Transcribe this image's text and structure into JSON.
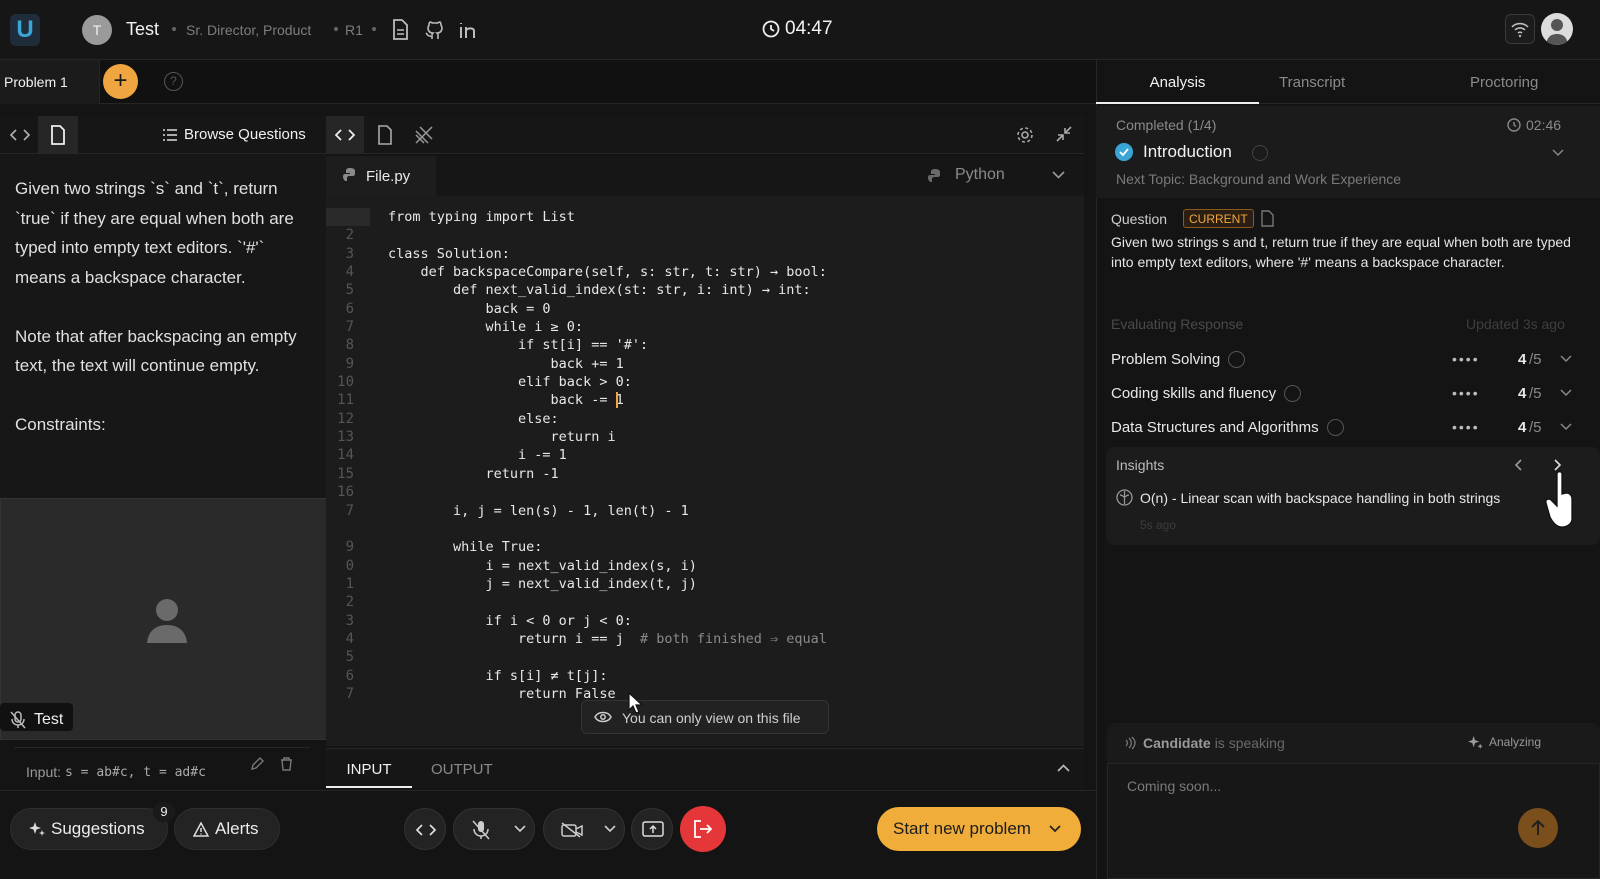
{
  "header": {
    "logo": "U",
    "avatar_initial": "T",
    "candidate_name": "Test",
    "role": "Sr. Director, Product",
    "round": "R1",
    "timer": "04:47",
    "icons": [
      "document-icon",
      "github-icon",
      "linkedin-icon",
      "clock-icon",
      "wifi-icon"
    ]
  },
  "problem_tabs": {
    "current": "Problem 1",
    "add_label": "+",
    "help": "?"
  },
  "left_panel": {
    "browse_label": "Browse Questions",
    "paragraphs": [
      "Given two strings `s` and `t`, return `true` if they are equal when both are typed into empty text editors. `'#'` means a backspace character.",
      "Note that after backspacing an empty text, the text will continue empty.",
      "Constraints:"
    ],
    "video_label": "Test",
    "input_label": "Input:",
    "input_value": "s = ab#c, t = ad#c"
  },
  "editor": {
    "file_name": "File.py",
    "language": "Python",
    "line_numbers": [
      "",
      "2",
      "3",
      "4",
      "5",
      "6",
      "7",
      "8",
      "9",
      "10",
      "11",
      "12",
      "13",
      "14",
      "15",
      "16",
      "7",
      "",
      "9",
      "0",
      "1",
      "2",
      "3",
      "4",
      "5",
      "6",
      "7"
    ],
    "code": [
      "from typing import List",
      "",
      "class Solution:",
      "    def backspaceCompare(self, s: str, t: str) → bool:",
      "        def next_valid_index(st: str, i: int) → int:",
      "            back = 0",
      "            while i ≥ 0:",
      "                if st[i] == '#':",
      "                    back += 1",
      "                elif back > 0:",
      "                    back -= 1",
      "                else:",
      "                    return i",
      "                i -= 1",
      "            return -1",
      "",
      "        i, j = len(s) - 1, len(t) - 1",
      "",
      "        while True:",
      "            i = next_valid_index(s, i)",
      "            j = next_valid_index(t, j)",
      "",
      "            if i < 0 or j < 0:",
      "                return i == j  # both finished ⇒ equal",
      "",
      "            if s[i] ≠ t[j]:",
      "                return False"
    ],
    "toast": "You can only view on this file",
    "io_tabs": [
      "INPUT",
      "OUTPUT"
    ]
  },
  "bottom_bar": {
    "suggestions_label": "Suggestions",
    "suggestions_count": "9",
    "alerts_label": "Alerts",
    "start_label": "Start new problem"
  },
  "right_panel": {
    "tabs": [
      "Analysis",
      "Transcript",
      "Proctoring"
    ],
    "completed": "Completed (1/4)",
    "completed_time": "02:46",
    "topic": "Introduction",
    "next_topic": "Next Topic: Background and Work Experience",
    "question_label": "Question",
    "current_badge": "CURRENT",
    "question_text": "Given two strings s and t, return true if they are equal when both are typed into empty text editors, where '#' means a backspace character.",
    "evaluating": "Evaluating Response",
    "updated": "Updated 3s ago",
    "scores": [
      {
        "label": "Problem Solving",
        "score": "4",
        "max": "/5"
      },
      {
        "label": "Coding skills and fluency",
        "score": "4",
        "max": "/5"
      },
      {
        "label": "Data Structures and Algorithms",
        "score": "4",
        "max": "/5"
      }
    ],
    "insights_label": "Insights",
    "insight_text": "O(n) - Linear scan with backspace handling in both strings",
    "insight_time": "5s ago",
    "speaker": "Candidate",
    "speaking": "is speaking",
    "analyzing": "Analyzing",
    "coming_soon": "Coming soon..."
  },
  "colors": {
    "accent": "#f0a640",
    "danger": "#e5373a",
    "check": "#3aa6d8"
  }
}
